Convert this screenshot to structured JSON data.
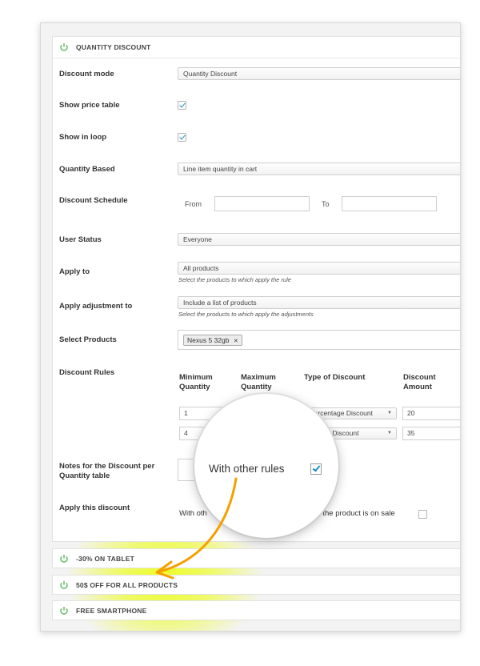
{
  "main_panel": {
    "title": "QUANTITY DISCOUNT",
    "fields": {
      "discount_mode": {
        "label": "Discount mode",
        "value": "Quantity Discount"
      },
      "show_price_table": {
        "label": "Show price table",
        "checked": true
      },
      "show_in_loop": {
        "label": "Show in loop",
        "checked": true
      },
      "quantity_based": {
        "label": "Quantity Based",
        "value": "Line item quantity in cart"
      },
      "discount_schedule": {
        "label": "Discount Schedule",
        "from_label": "From",
        "to_label": "To",
        "from_value": "",
        "to_value": ""
      },
      "user_status": {
        "label": "User Status",
        "value": "Everyone"
      },
      "apply_to": {
        "label": "Apply to",
        "value": "All products",
        "hint": "Select the products to which apply the rule"
      },
      "apply_adjustment_to": {
        "label": "Apply adjustment to",
        "value": "Include a list of products",
        "hint": "Select the products to which apply the adjustments"
      },
      "select_products": {
        "label": "Select Products",
        "tags": [
          "Nexus 5 32gb"
        ],
        "tag_remove": "✕"
      },
      "discount_rules": {
        "label": "Discount Rules",
        "headers": {
          "min_qty": "Minimum Quantity",
          "max_qty": "Maximum Quantity",
          "type": "Type of Discount",
          "amount": "Discount Amount"
        },
        "headers_lines": {
          "min_qty": [
            "Minimum",
            "Quantity"
          ],
          "max_qty": [
            "Maximum",
            "Quantity"
          ],
          "amount": [
            "Discount",
            "Amount"
          ]
        },
        "rows": [
          {
            "min": "1",
            "type": "Percentage Discount",
            "amount": "20"
          },
          {
            "min": "4",
            "type": "entage Discount",
            "amount": "35"
          }
        ]
      },
      "notes": {
        "label": "Notes for the Discount per Quantity table",
        "label_lines": [
          "Notes for the Discount per",
          "Quantity table"
        ]
      },
      "apply_this_discount": {
        "label": "Apply this discount",
        "with_other_partial": "With oth",
        "on_sale_partial": "if the product is on sale",
        "on_sale_checked": false
      }
    }
  },
  "magnifier": {
    "text": "With other rules",
    "checked": true
  },
  "collapsed_panels": [
    {
      "title": "-30% ON TABLET"
    },
    {
      "title": "50$ OFF FOR ALL PRODUCTS"
    },
    {
      "title": "FREE SMARTPHONE"
    }
  ],
  "colors": {
    "power_icon": "#5cb85c",
    "highlight": "#ecff00",
    "arrow": "#f5a000",
    "checkbox_tick": "#1e8cbe"
  },
  "icons": {
    "power": "power-icon",
    "caret": "chevron-down-icon"
  }
}
